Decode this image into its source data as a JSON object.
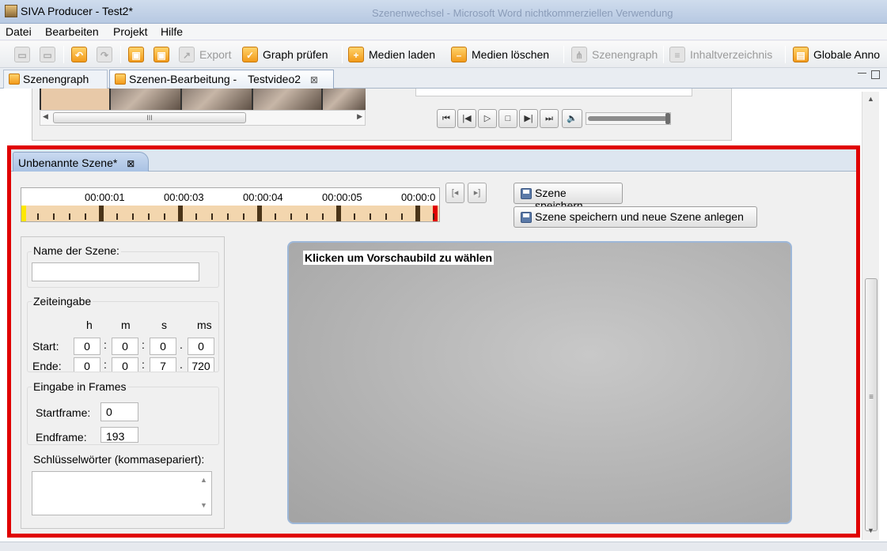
{
  "window": {
    "title": "SIVA Producer - Test2*",
    "background_title": "Szenenwechsel - Microsoft Word nichtkommerziellen Verwendung"
  },
  "menu": [
    "Datei",
    "Bearbeiten",
    "Projekt",
    "Hilfe"
  ],
  "toolbar": {
    "export": "Export",
    "graph_pruefen": "Graph prüfen",
    "medien_laden": "Medien laden",
    "medien_loeschen": "Medien löschen",
    "szenengraph": "Szenengraph",
    "inhaltsverzeichnis": "Inhaltverzeichnis",
    "globale": "Globale Anno"
  },
  "view_tabs": {
    "szenengraph": "Szenengraph",
    "edit_title": "Szenen-Bearbeitung -",
    "edit_video": "Testvideo2",
    "close": "⊠"
  },
  "player": {
    "controls": [
      "first",
      "prev",
      "play",
      "stop",
      "next",
      "last",
      "volume"
    ]
  },
  "scene": {
    "tab_title": "Unbenannte Szene*",
    "tab_close": "⊠",
    "timeline_labels": [
      "00:00:01",
      "00:00:03",
      "00:00:04",
      "00:00:05",
      "00:00:0"
    ],
    "save_button": "Szene speichern",
    "save_new_button": "Szene speichern und neue Szene anlegen",
    "name_group": "Name der Szene:",
    "name_value": "",
    "time_group": "Zeiteingabe",
    "time_headers": [
      "h",
      "m",
      "s",
      "ms"
    ],
    "start_label": "Start:",
    "end_label": "Ende:",
    "start_values": [
      "0",
      "0",
      "0",
      "0"
    ],
    "end_values": [
      "0",
      "0",
      "7",
      "720"
    ],
    "frames_group": "Eingabe in Frames",
    "startframe_label": "Startframe:",
    "startframe_value": "0",
    "endframe_label": "Endframe:",
    "endframe_value": "193",
    "keywords_label": "Schlüsselwörter (kommasepariert):",
    "keywords_value": "",
    "preview_caption": "Klicken um Vorschaubild zu wählen"
  },
  "colors": {
    "highlight_border": "#e00000",
    "timeline_fill": "#f3d6ae",
    "timeline_start": "#ffe700",
    "timeline_end": "#e00000"
  }
}
